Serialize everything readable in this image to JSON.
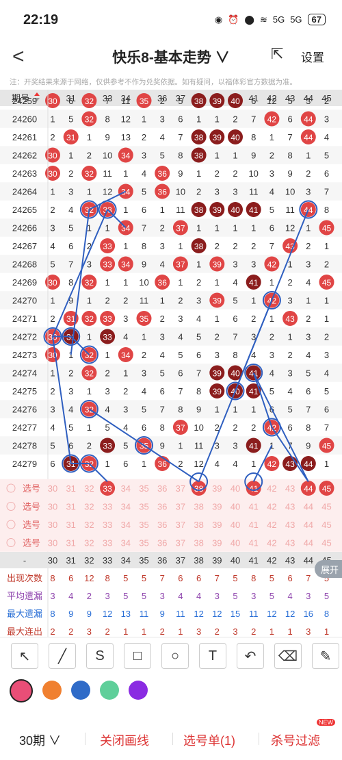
{
  "status_bar": {
    "time": "22:19",
    "net1": "5G",
    "net2": "5G",
    "battery": "67"
  },
  "header": {
    "back": "<",
    "title": "快乐8-基本走势 ∨",
    "settings": "设置"
  },
  "notice": "注：开奖结果来源于网络，仅供参考不作为兑奖依据。如有疑问，以福体彩官方数据为准。",
  "table": {
    "period_header": "期号",
    "columns": [
      "30",
      "31",
      "32",
      "33",
      "34",
      "35",
      "36",
      "37",
      "38",
      "39",
      "40",
      "41",
      "42",
      "43",
      "44",
      "45"
    ],
    "rows": [
      {
        "period": "24259",
        "cells": [
          "30",
          "6",
          "32",
          "7",
          "11",
          "35",
          "2",
          "5",
          "38",
          "39",
          "40",
          "6",
          "12",
          "5",
          "3",
          "2"
        ]
      },
      {
        "period": "24260",
        "cells": [
          "1",
          "5",
          "32",
          "8",
          "12",
          "1",
          "3",
          "6",
          "1",
          "1",
          "2",
          "7",
          "42",
          "6",
          "44",
          "3"
        ]
      },
      {
        "period": "24261",
        "cells": [
          "2",
          "31",
          "1",
          "9",
          "13",
          "2",
          "4",
          "7",
          "38",
          "39",
          "40",
          "8",
          "1",
          "7",
          "44",
          "4"
        ]
      },
      {
        "period": "24262",
        "cells": [
          "30",
          "1",
          "2",
          "10",
          "34",
          "3",
          "5",
          "8",
          "38",
          "1",
          "1",
          "9",
          "2",
          "8",
          "1",
          "5"
        ]
      },
      {
        "period": "24263",
        "cells": [
          "30",
          "2",
          "32",
          "11",
          "1",
          "4",
          "36",
          "9",
          "1",
          "2",
          "2",
          "10",
          "3",
          "9",
          "2",
          "6"
        ]
      },
      {
        "period": "24264",
        "cells": [
          "1",
          "3",
          "1",
          "12",
          "34",
          "5",
          "36",
          "10",
          "2",
          "3",
          "3",
          "11",
          "4",
          "10",
          "3",
          "7"
        ]
      },
      {
        "period": "24265",
        "cells": [
          "2",
          "4",
          "32",
          "33",
          "1",
          "6",
          "1",
          "11",
          "38",
          "39",
          "40",
          "41",
          "5",
          "11",
          "44",
          "8"
        ]
      },
      {
        "period": "24266",
        "cells": [
          "3",
          "5",
          "1",
          "1",
          "34",
          "7",
          "2",
          "37",
          "1",
          "1",
          "1",
          "1",
          "6",
          "12",
          "1",
          "45"
        ]
      },
      {
        "period": "24267",
        "cells": [
          "4",
          "6",
          "2",
          "33",
          "1",
          "8",
          "3",
          "1",
          "38",
          "2",
          "2",
          "2",
          "7",
          "43",
          "2",
          "1"
        ]
      },
      {
        "period": "24268",
        "cells": [
          "5",
          "7",
          "3",
          "33",
          "34",
          "9",
          "4",
          "37",
          "1",
          "39",
          "3",
          "3",
          "42",
          "1",
          "3",
          "2"
        ]
      },
      {
        "period": "24269",
        "cells": [
          "30",
          "8",
          "32",
          "1",
          "1",
          "10",
          "36",
          "1",
          "2",
          "1",
          "4",
          "41",
          "1",
          "2",
          "4",
          "45"
        ]
      },
      {
        "period": "24270",
        "cells": [
          "1",
          "9",
          "1",
          "2",
          "2",
          "11",
          "1",
          "2",
          "3",
          "39",
          "5",
          "1",
          "42",
          "3",
          "1",
          "1"
        ]
      },
      {
        "period": "24271",
        "cells": [
          "2",
          "31",
          "32",
          "33",
          "3",
          "35",
          "2",
          "3",
          "4",
          "1",
          "6",
          "2",
          "1",
          "43",
          "2",
          "1"
        ]
      },
      {
        "period": "24272",
        "cells": [
          "30",
          "31",
          "1",
          "33",
          "4",
          "1",
          "3",
          "4",
          "5",
          "2",
          "7",
          "3",
          "2",
          "1",
          "3",
          "2"
        ]
      },
      {
        "period": "24273",
        "cells": [
          "30",
          "1",
          "32",
          "1",
          "34",
          "2",
          "4",
          "5",
          "6",
          "3",
          "8",
          "4",
          "3",
          "2",
          "4",
          "3"
        ]
      },
      {
        "period": "24274",
        "cells": [
          "1",
          "2",
          "32",
          "2",
          "1",
          "3",
          "5",
          "6",
          "7",
          "39",
          "40",
          "41",
          "4",
          "3",
          "5",
          "4"
        ]
      },
      {
        "period": "24275",
        "cells": [
          "2",
          "3",
          "1",
          "3",
          "2",
          "4",
          "6",
          "7",
          "8",
          "39",
          "40",
          "41",
          "5",
          "4",
          "6",
          "5"
        ]
      },
      {
        "period": "24276",
        "cells": [
          "3",
          "4",
          "32",
          "4",
          "3",
          "5",
          "7",
          "8",
          "9",
          "1",
          "1",
          "1",
          "6",
          "5",
          "7",
          "6"
        ]
      },
      {
        "period": "24277",
        "cells": [
          "4",
          "5",
          "1",
          "5",
          "4",
          "6",
          "8",
          "37",
          "10",
          "2",
          "2",
          "2",
          "42",
          "6",
          "8",
          "7"
        ]
      },
      {
        "period": "24278",
        "cells": [
          "5",
          "6",
          "2",
          "33",
          "5",
          "35",
          "9",
          "1",
          "11",
          "3",
          "3",
          "41",
          "1",
          "7",
          "9",
          "45"
        ]
      },
      {
        "period": "24279",
        "cells": [
          "6",
          "31",
          "32",
          "1",
          "6",
          "1",
          "36",
          "2",
          "12",
          "4",
          "4",
          "1",
          "42",
          "43",
          "44",
          "1"
        ]
      }
    ],
    "select_label": "选号",
    "summary_rows": [
      {
        "label": "出现次数",
        "cells": [
          "8",
          "6",
          "12",
          "8",
          "5",
          "5",
          "7",
          "6",
          "6",
          "7",
          "5",
          "8",
          "5",
          "6",
          "7",
          "5"
        ]
      },
      {
        "label": "平均遗漏",
        "cells": [
          "3",
          "4",
          "2",
          "3",
          "5",
          "5",
          "3",
          "4",
          "4",
          "3",
          "5",
          "3",
          "5",
          "4",
          "3",
          "5"
        ]
      },
      {
        "label": "最大遗漏",
        "cells": [
          "8",
          "9",
          "9",
          "12",
          "13",
          "11",
          "9",
          "11",
          "12",
          "12",
          "15",
          "11",
          "12",
          "12",
          "16",
          "8"
        ]
      },
      {
        "label": "最大连出",
        "cells": [
          "2",
          "2",
          "3",
          "2",
          "1",
          "1",
          "2",
          "1",
          "3",
          "2",
          "3",
          "2",
          "1",
          "1",
          "3",
          "1"
        ]
      }
    ],
    "expand_label": "展开"
  },
  "draw_tools": [
    {
      "icon": "arrow-icon",
      "glyph": "↖"
    },
    {
      "icon": "line-icon",
      "glyph": "╱"
    },
    {
      "icon": "curve-icon",
      "glyph": "S"
    },
    {
      "icon": "rectangle-icon",
      "glyph": "□"
    },
    {
      "icon": "circle-icon",
      "glyph": "○"
    },
    {
      "icon": "text-icon",
      "glyph": "T"
    },
    {
      "icon": "undo-icon",
      "glyph": "↶"
    },
    {
      "icon": "eraser-icon",
      "glyph": "⌫"
    },
    {
      "icon": "clear-brush-icon",
      "glyph": "✎"
    }
  ],
  "colors": [
    "#e94e77",
    "#f08030",
    "#2f6bc8",
    "#5fcf9a",
    "#8a2be2"
  ],
  "footer": {
    "period": "30期 ∨",
    "close_lines": "关闭画线",
    "selection": "选号单(1)",
    "filter": "杀号过滤",
    "new_badge": "NEW"
  }
}
